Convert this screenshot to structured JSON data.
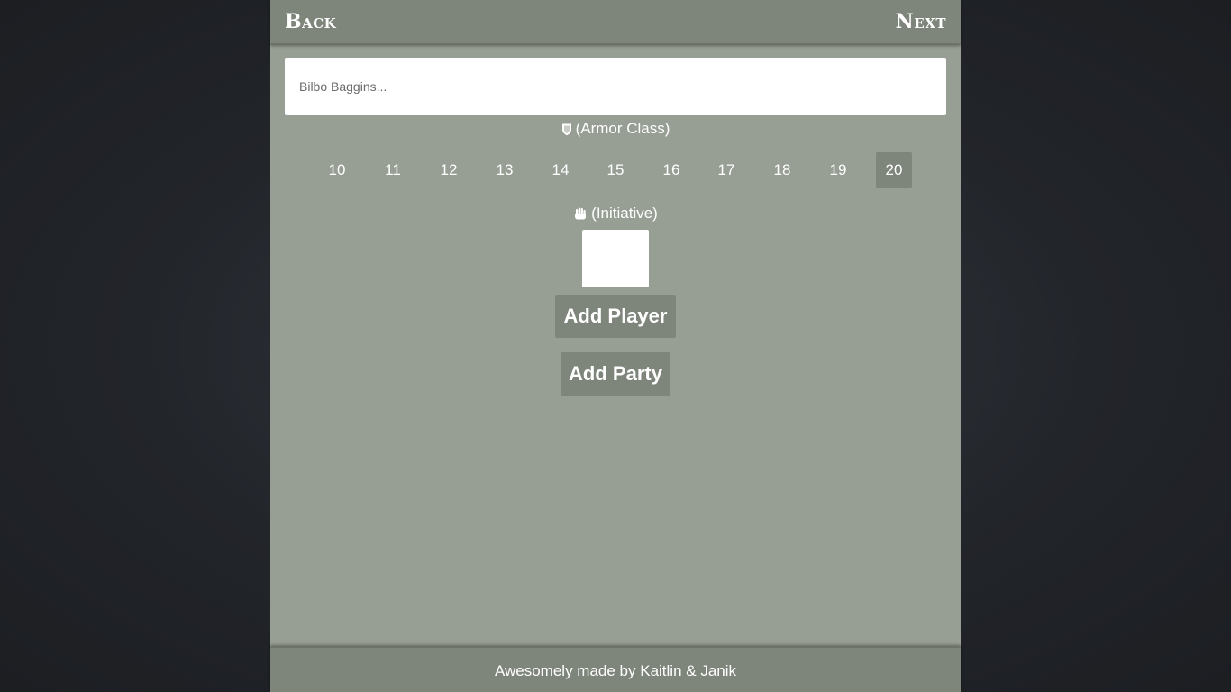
{
  "nav": {
    "back_label": "Back",
    "next_label": "Next"
  },
  "player_form": {
    "name_placeholder": "Bilbo Baggins...",
    "name_value": "",
    "armor_class_label": "(Armor Class)",
    "armor_class_icon": "shield-icon",
    "armor_class_options": [
      "10",
      "11",
      "12",
      "13",
      "14",
      "15",
      "16",
      "17",
      "18",
      "19",
      "20"
    ],
    "armor_class_selected": "20",
    "initiative_label": "(Initiative)",
    "initiative_icon": "hand-icon",
    "initiative_value": ""
  },
  "actions": {
    "add_player_label": "Add Player",
    "add_party_label": "Add Party"
  },
  "footer": {
    "credit_text": "Awesomely made by Kaitlin & Janik"
  },
  "colors": {
    "panel_bg": "#979e94",
    "bar_bg": "#7e857b",
    "page_bg": "#22252a",
    "text": "#ffffff"
  }
}
